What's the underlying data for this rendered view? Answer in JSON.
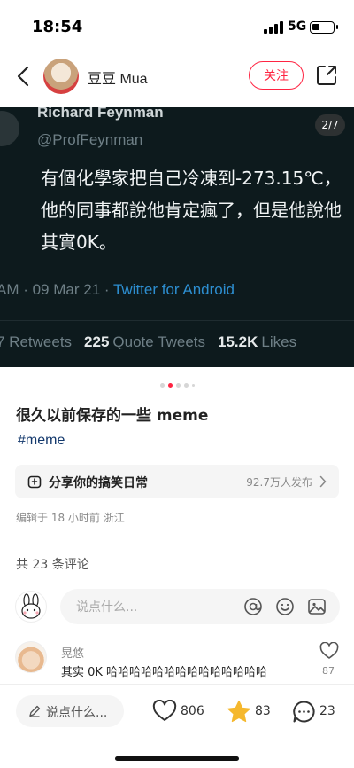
{
  "status_bar": {
    "time": "18:54",
    "network": "5G"
  },
  "header": {
    "author_name": "豆豆 Mua",
    "follow_label": "关注"
  },
  "media": {
    "page_indicator": "2/7",
    "tweet": {
      "name": "Richard Feynman",
      "handle": "@ProfFeynman",
      "text": "有個化學家把自己冷凍到-273.15℃，他的同事都說他肯定瘋了，但是他說他其實0K。",
      "meta_time": "AM · 09 Mar 21 · ",
      "meta_source": "Twitter for Android",
      "retweets_label": "7 Retweets",
      "quote_count": "225",
      "quote_label": "Quote Tweets",
      "likes_count": "15.2K",
      "likes_label": "Likes"
    }
  },
  "carousel": {
    "total_dots": 5,
    "active_index": 1
  },
  "post": {
    "title": "很久以前保存的一些 meme",
    "tag": "#meme",
    "collection_label": "分享你的搞笑日常",
    "collection_count": "92.7万人发布",
    "edit_info": "编辑于 18 小时前 浙江"
  },
  "comments": {
    "count_label": "共 23 条评论",
    "input_placeholder": "说点什么...",
    "items": [
      {
        "name": "晃悠",
        "text": "其实 0K 哈哈哈哈哈哈哈哈哈哈哈哈哈哈",
        "likes": "87"
      }
    ]
  },
  "bottom_bar": {
    "input_placeholder": "说点什么...",
    "likes": "806",
    "collects": "83",
    "comments": "23"
  },
  "colors": {
    "accent": "#ff2442",
    "tag": "#13386c",
    "star": "#f5b82e"
  }
}
